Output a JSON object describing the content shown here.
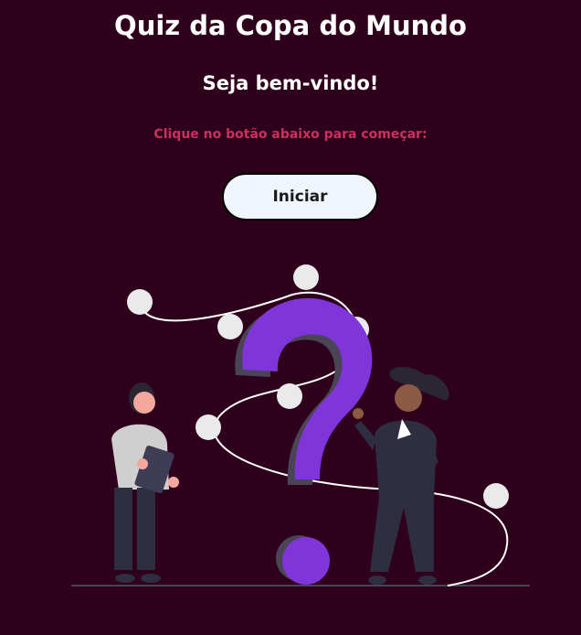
{
  "header": {
    "title": "Quiz da Copa do Mundo",
    "subtitle": "Seja bem-vindo!",
    "prompt": "Clique no botão abaixo para começar:"
  },
  "actions": {
    "start_label": "Iniciar"
  },
  "illustration": {
    "name": "question-mark-with-people",
    "accent_color": "#7f35d9"
  },
  "colors": {
    "background": "#2e001c",
    "title": "#ffffff",
    "prompt": "#c9315e",
    "button_bg": "#f1f5fd"
  }
}
